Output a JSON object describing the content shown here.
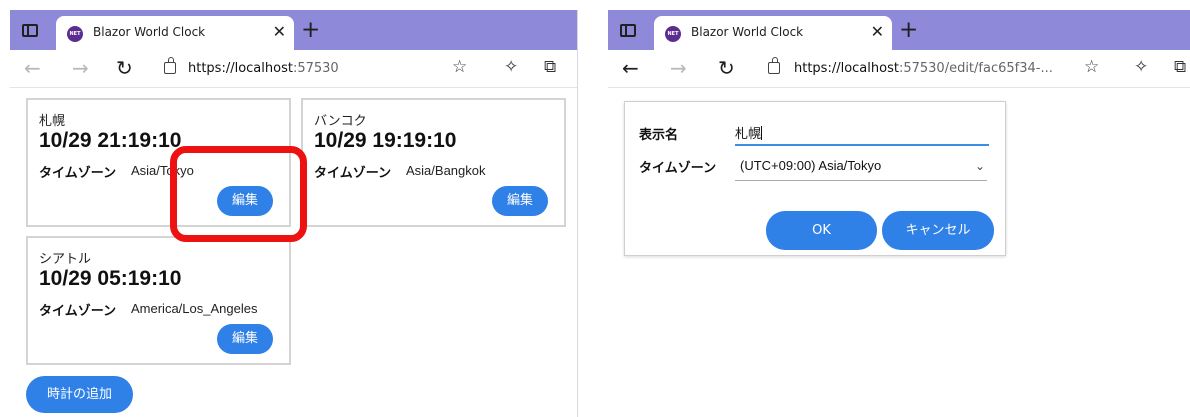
{
  "left_window": {
    "tab_title": "Blazor World Clock",
    "favicon_text": "NET",
    "url_host": "https://localhost",
    "url_rest": ":57530",
    "cards": [
      {
        "city": "札幌",
        "time": "10/29 21:19:10",
        "tz_label": "タイムゾーン",
        "tz": "Asia/Tokyo",
        "edit": "編集"
      },
      {
        "city": "バンコク",
        "time": "10/29 19:19:10",
        "tz_label": "タイムゾーン",
        "tz": "Asia/Bangkok",
        "edit": "編集"
      },
      {
        "city": "シアトル",
        "time": "10/29 05:19:10",
        "tz_label": "タイムゾーン",
        "tz": "America/Los_Angeles",
        "edit": "編集"
      }
    ],
    "add_button": "時計の追加"
  },
  "right_window": {
    "tab_title": "Blazor World Clock",
    "favicon_text": "NET",
    "url_host": "https://localhost",
    "url_rest": ":57530/edit/fac65f34-...",
    "form": {
      "name_label": "表示名",
      "name_value": "札幌",
      "tz_label": "タイムゾーン",
      "tz_value": "(UTC+09:00) Asia/Tokyo",
      "ok": "OK",
      "cancel": "キャンセル"
    }
  },
  "colors": {
    "tabbar": "#8e89d8",
    "button": "#2f80e7",
    "highlight": "#ee1111"
  },
  "icons": [
    "tab-actions-icon",
    "close-icon",
    "new-tab-icon",
    "back-icon",
    "forward-icon",
    "refresh-icon",
    "lock-icon",
    "favorites-icon",
    "extensions-icon",
    "collections-icon"
  ]
}
